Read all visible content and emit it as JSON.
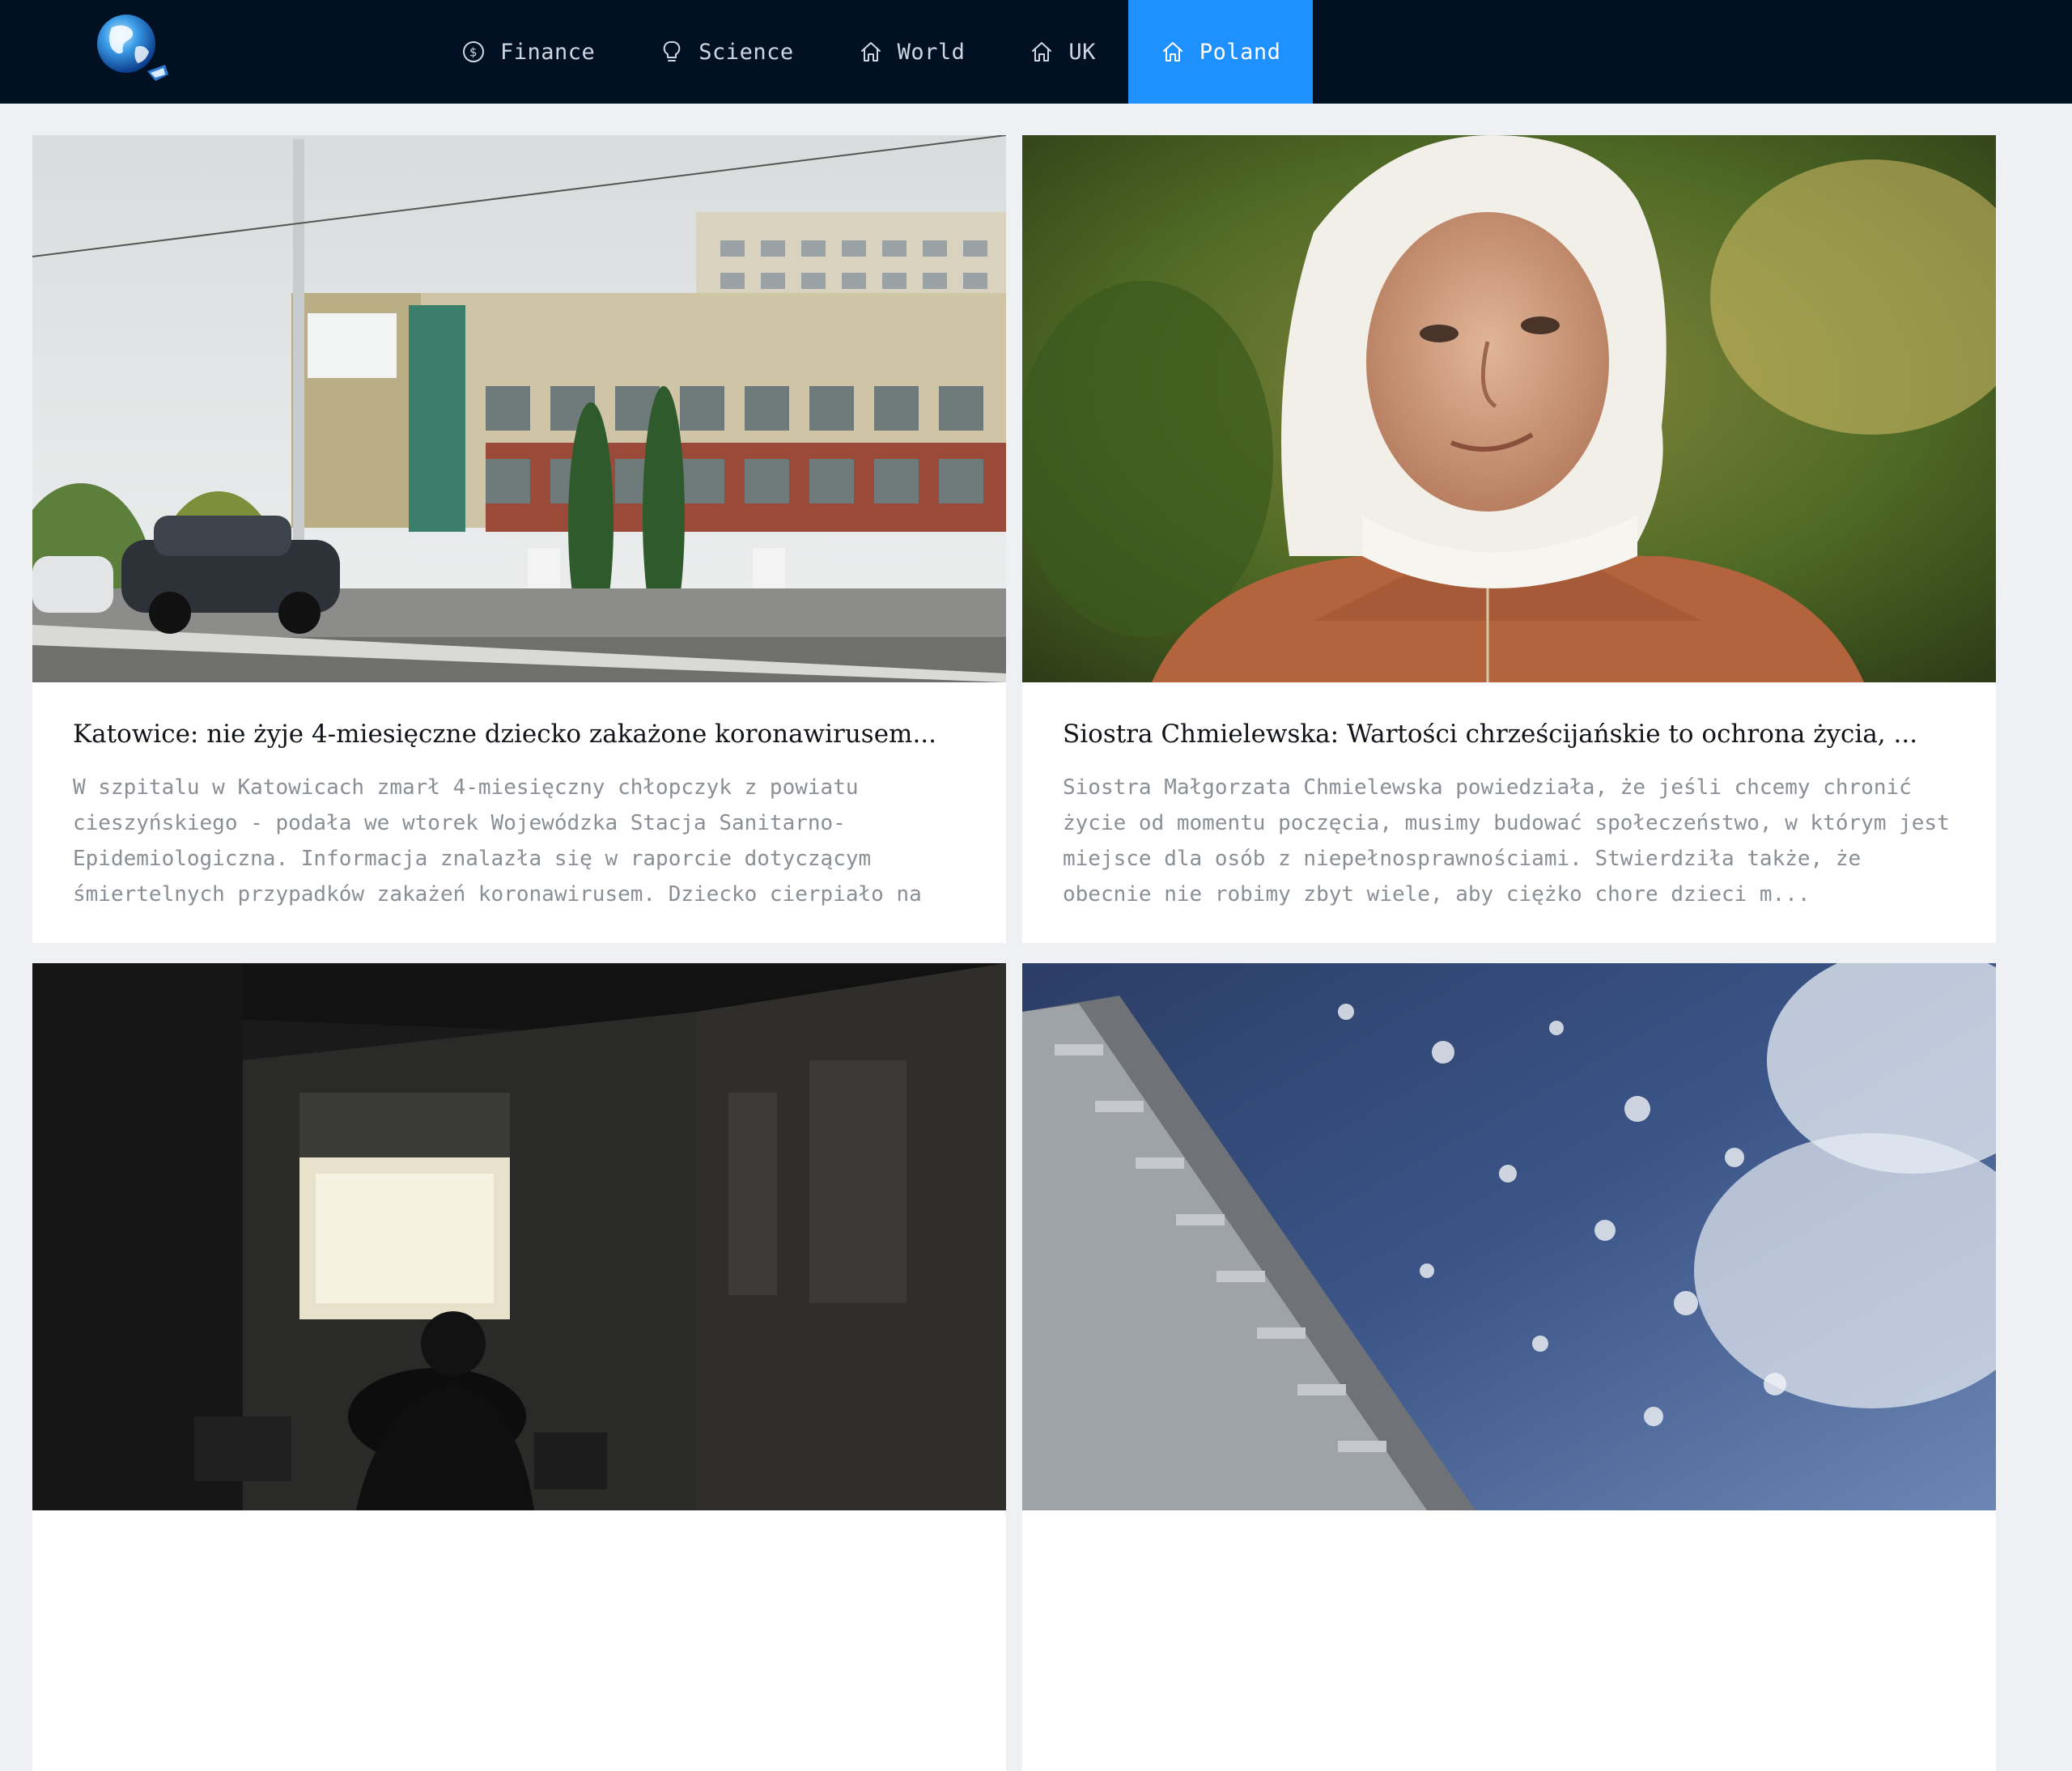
{
  "nav": {
    "logo_icon": "globe-logo-icon",
    "items": [
      {
        "label": "Finance",
        "icon": "dollar-circle-icon",
        "active": false
      },
      {
        "label": "Science",
        "icon": "lightbulb-icon",
        "active": false
      },
      {
        "label": "World",
        "icon": "home-icon",
        "active": false
      },
      {
        "label": "UK",
        "icon": "home-icon",
        "active": false
      },
      {
        "label": "Poland",
        "icon": "home-icon",
        "active": true
      }
    ],
    "colors": {
      "background": "#011022",
      "active": "#1e90ff",
      "text": "#cfd6e1"
    }
  },
  "articles": [
    {
      "title": "Katowice: nie żyje 4-miesięczne dziecko zakażone koronawirusem...",
      "excerpt": "W szpitalu w Katowicach zmarł 4-miesięczny chłopczyk z powiatu cieszyńskiego - podała we wtorek Wojewódzka Stacja Sanitarno-Epidemiologiczna. Informacja znalazła się w raporcie dotyczącym śmiertelnych przypadków zakażeń koronawirusem. Dziecko cierpiało na cho...",
      "image": "hospital-building-photo"
    },
    {
      "title": "Siostra Chmielewska: Wartości chrześcijańskie to ochrona życia, ...",
      "excerpt": "Siostra Małgorzata Chmielewska powiedziała, że jeśli chcemy chronić życie od momentu poczęcia, musimy budować społeczeństwo, w którym jest miejsce dla osób z niepełnosprawnościami. Stwierdziła także, że obecnie nie robimy zbyt wiele, aby ciężko chore dzieci m...",
      "image": "nun-portrait-photo"
    },
    {
      "title": "",
      "excerpt": "",
      "image": "hospital-corridor-photo"
    },
    {
      "title": "",
      "excerpt": "",
      "image": "satellite-earth-photo"
    }
  ]
}
